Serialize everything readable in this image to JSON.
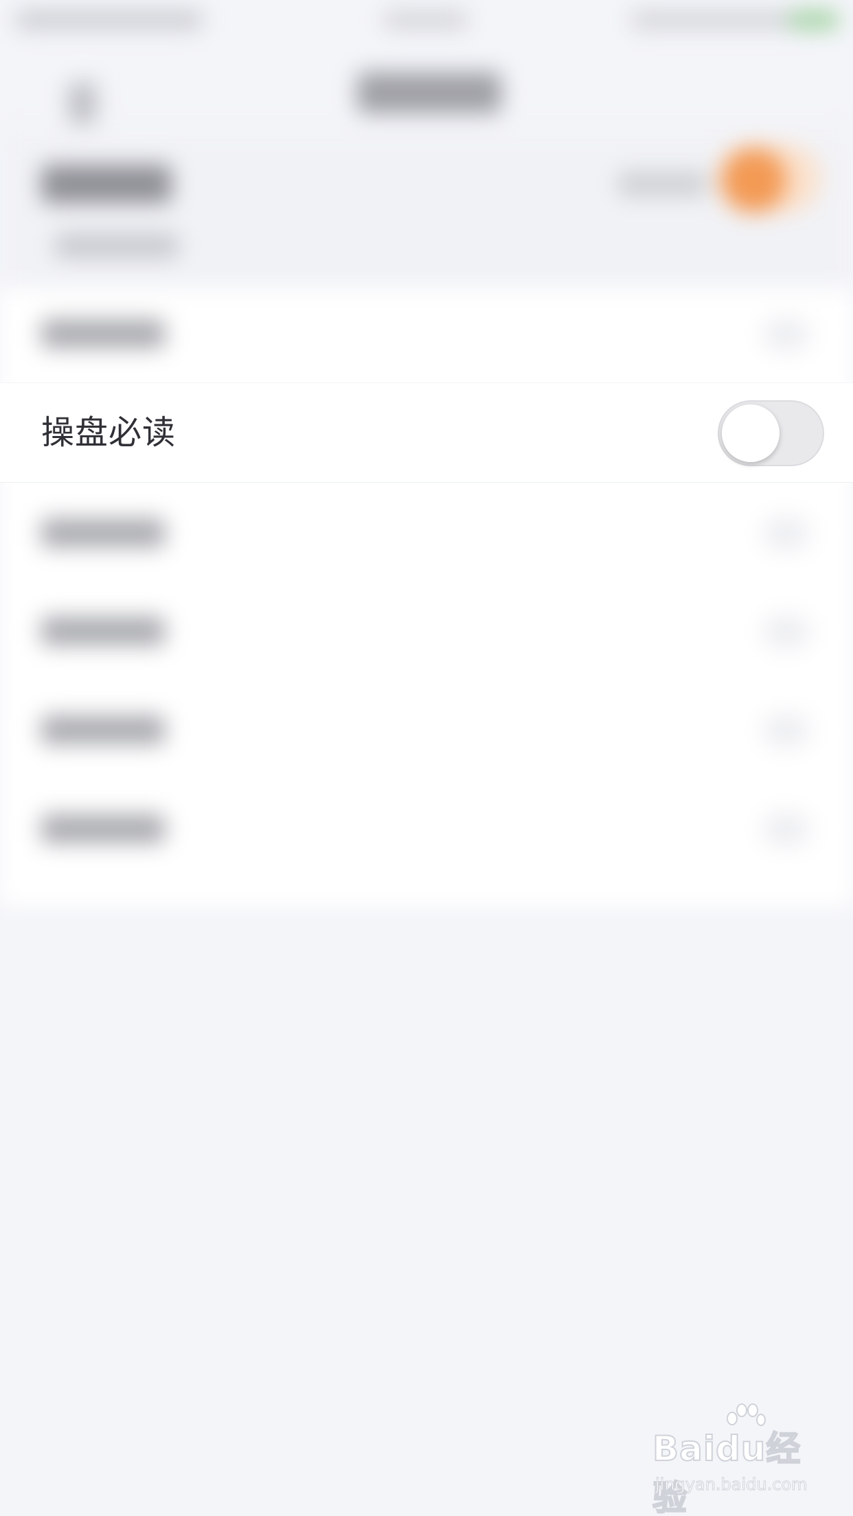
{
  "setting_row": {
    "label": "操盘必读",
    "toggle_on": false
  },
  "watermark": {
    "brand": "Baidu经验",
    "url": "jingyan.baidu.com"
  },
  "colors": {
    "background": "#f4f5f9",
    "row_background": "#ffffff",
    "label_text": "#2f3036",
    "toggle_off_track": "#e9e9ec",
    "accent_orange": "#f39a55"
  }
}
